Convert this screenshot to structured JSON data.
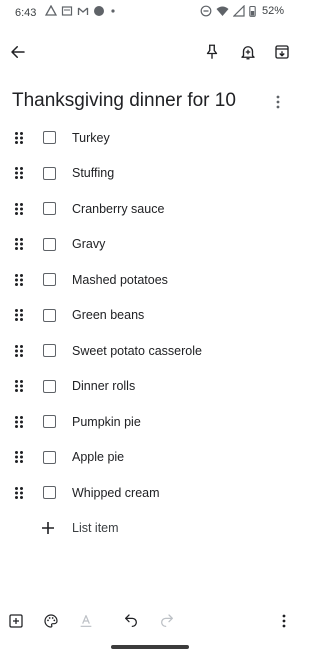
{
  "status": {
    "time": "6:43",
    "battery": "52%"
  },
  "note": {
    "title": "Thanksgiving dinner for 10",
    "items": [
      {
        "label": "Turkey",
        "checked": false
      },
      {
        "label": "Stuffing",
        "checked": false
      },
      {
        "label": "Cranberry sauce",
        "checked": false
      },
      {
        "label": "Gravy",
        "checked": false
      },
      {
        "label": "Mashed potatoes",
        "checked": false
      },
      {
        "label": "Green beans",
        "checked": false
      },
      {
        "label": "Sweet potato casserole",
        "checked": false
      },
      {
        "label": "Dinner rolls",
        "checked": false
      },
      {
        "label": "Pumpkin pie",
        "checked": false
      },
      {
        "label": "Apple pie",
        "checked": false
      },
      {
        "label": "Whipped cream",
        "checked": false
      }
    ],
    "add_item_label": "List item"
  },
  "icons": {
    "back": "arrow-back-icon",
    "pin": "pin-icon",
    "reminder": "bell-add-icon",
    "archive": "archive-icon",
    "more": "more-vert-icon",
    "add": "add-box-icon",
    "palette": "palette-icon",
    "text_format": "text-format-icon",
    "undo": "undo-icon",
    "redo": "redo-icon"
  },
  "colors": {
    "text": "#202124",
    "icon": "#5f6368",
    "disabled": "#bdc1c6"
  }
}
